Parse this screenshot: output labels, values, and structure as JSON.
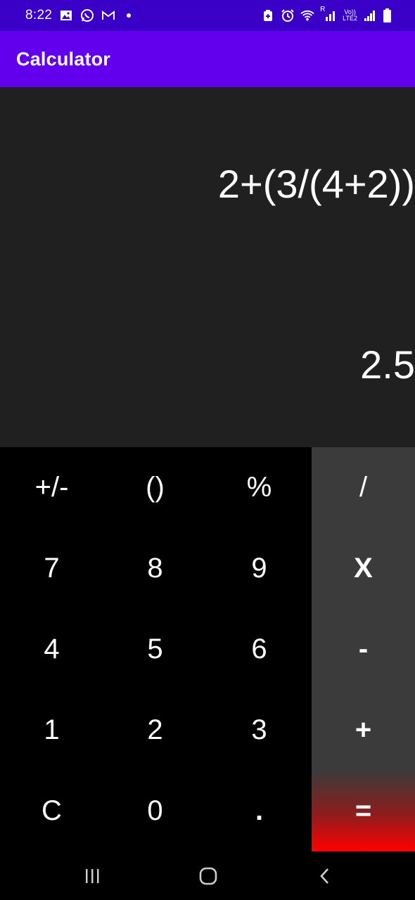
{
  "status_bar": {
    "time": "8:22",
    "left_icons": [
      "gallery-icon",
      "whatsapp-icon",
      "gmail-icon",
      "notification-dot"
    ],
    "right_icons": [
      "battery-saver-icon",
      "alarm-icon",
      "wifi-icon",
      "signal-icon",
      "volte-icon",
      "signal-2-icon",
      "battery-icon"
    ],
    "volte_label": "Vo))",
    "lte_label": "LTE2",
    "roaming_label": "R"
  },
  "app_bar": {
    "title": "Calculator",
    "color": "#6200ee"
  },
  "display": {
    "expression": "2+(3/(4+2))",
    "result": "2.5"
  },
  "keypad": {
    "rows": [
      [
        "+/-",
        "()",
        "%",
        "/"
      ],
      [
        "7",
        "8",
        "9",
        "X"
      ],
      [
        "4",
        "5",
        "6",
        "-"
      ],
      [
        "1",
        "2",
        "3",
        "+"
      ],
      [
        "C",
        "0",
        ".",
        "="
      ]
    ],
    "operator_color": "#3b3b3b",
    "equals_color": "#ff0000"
  },
  "nav_bar": {
    "buttons": [
      "recent-apps-icon",
      "home-icon",
      "back-icon"
    ]
  }
}
